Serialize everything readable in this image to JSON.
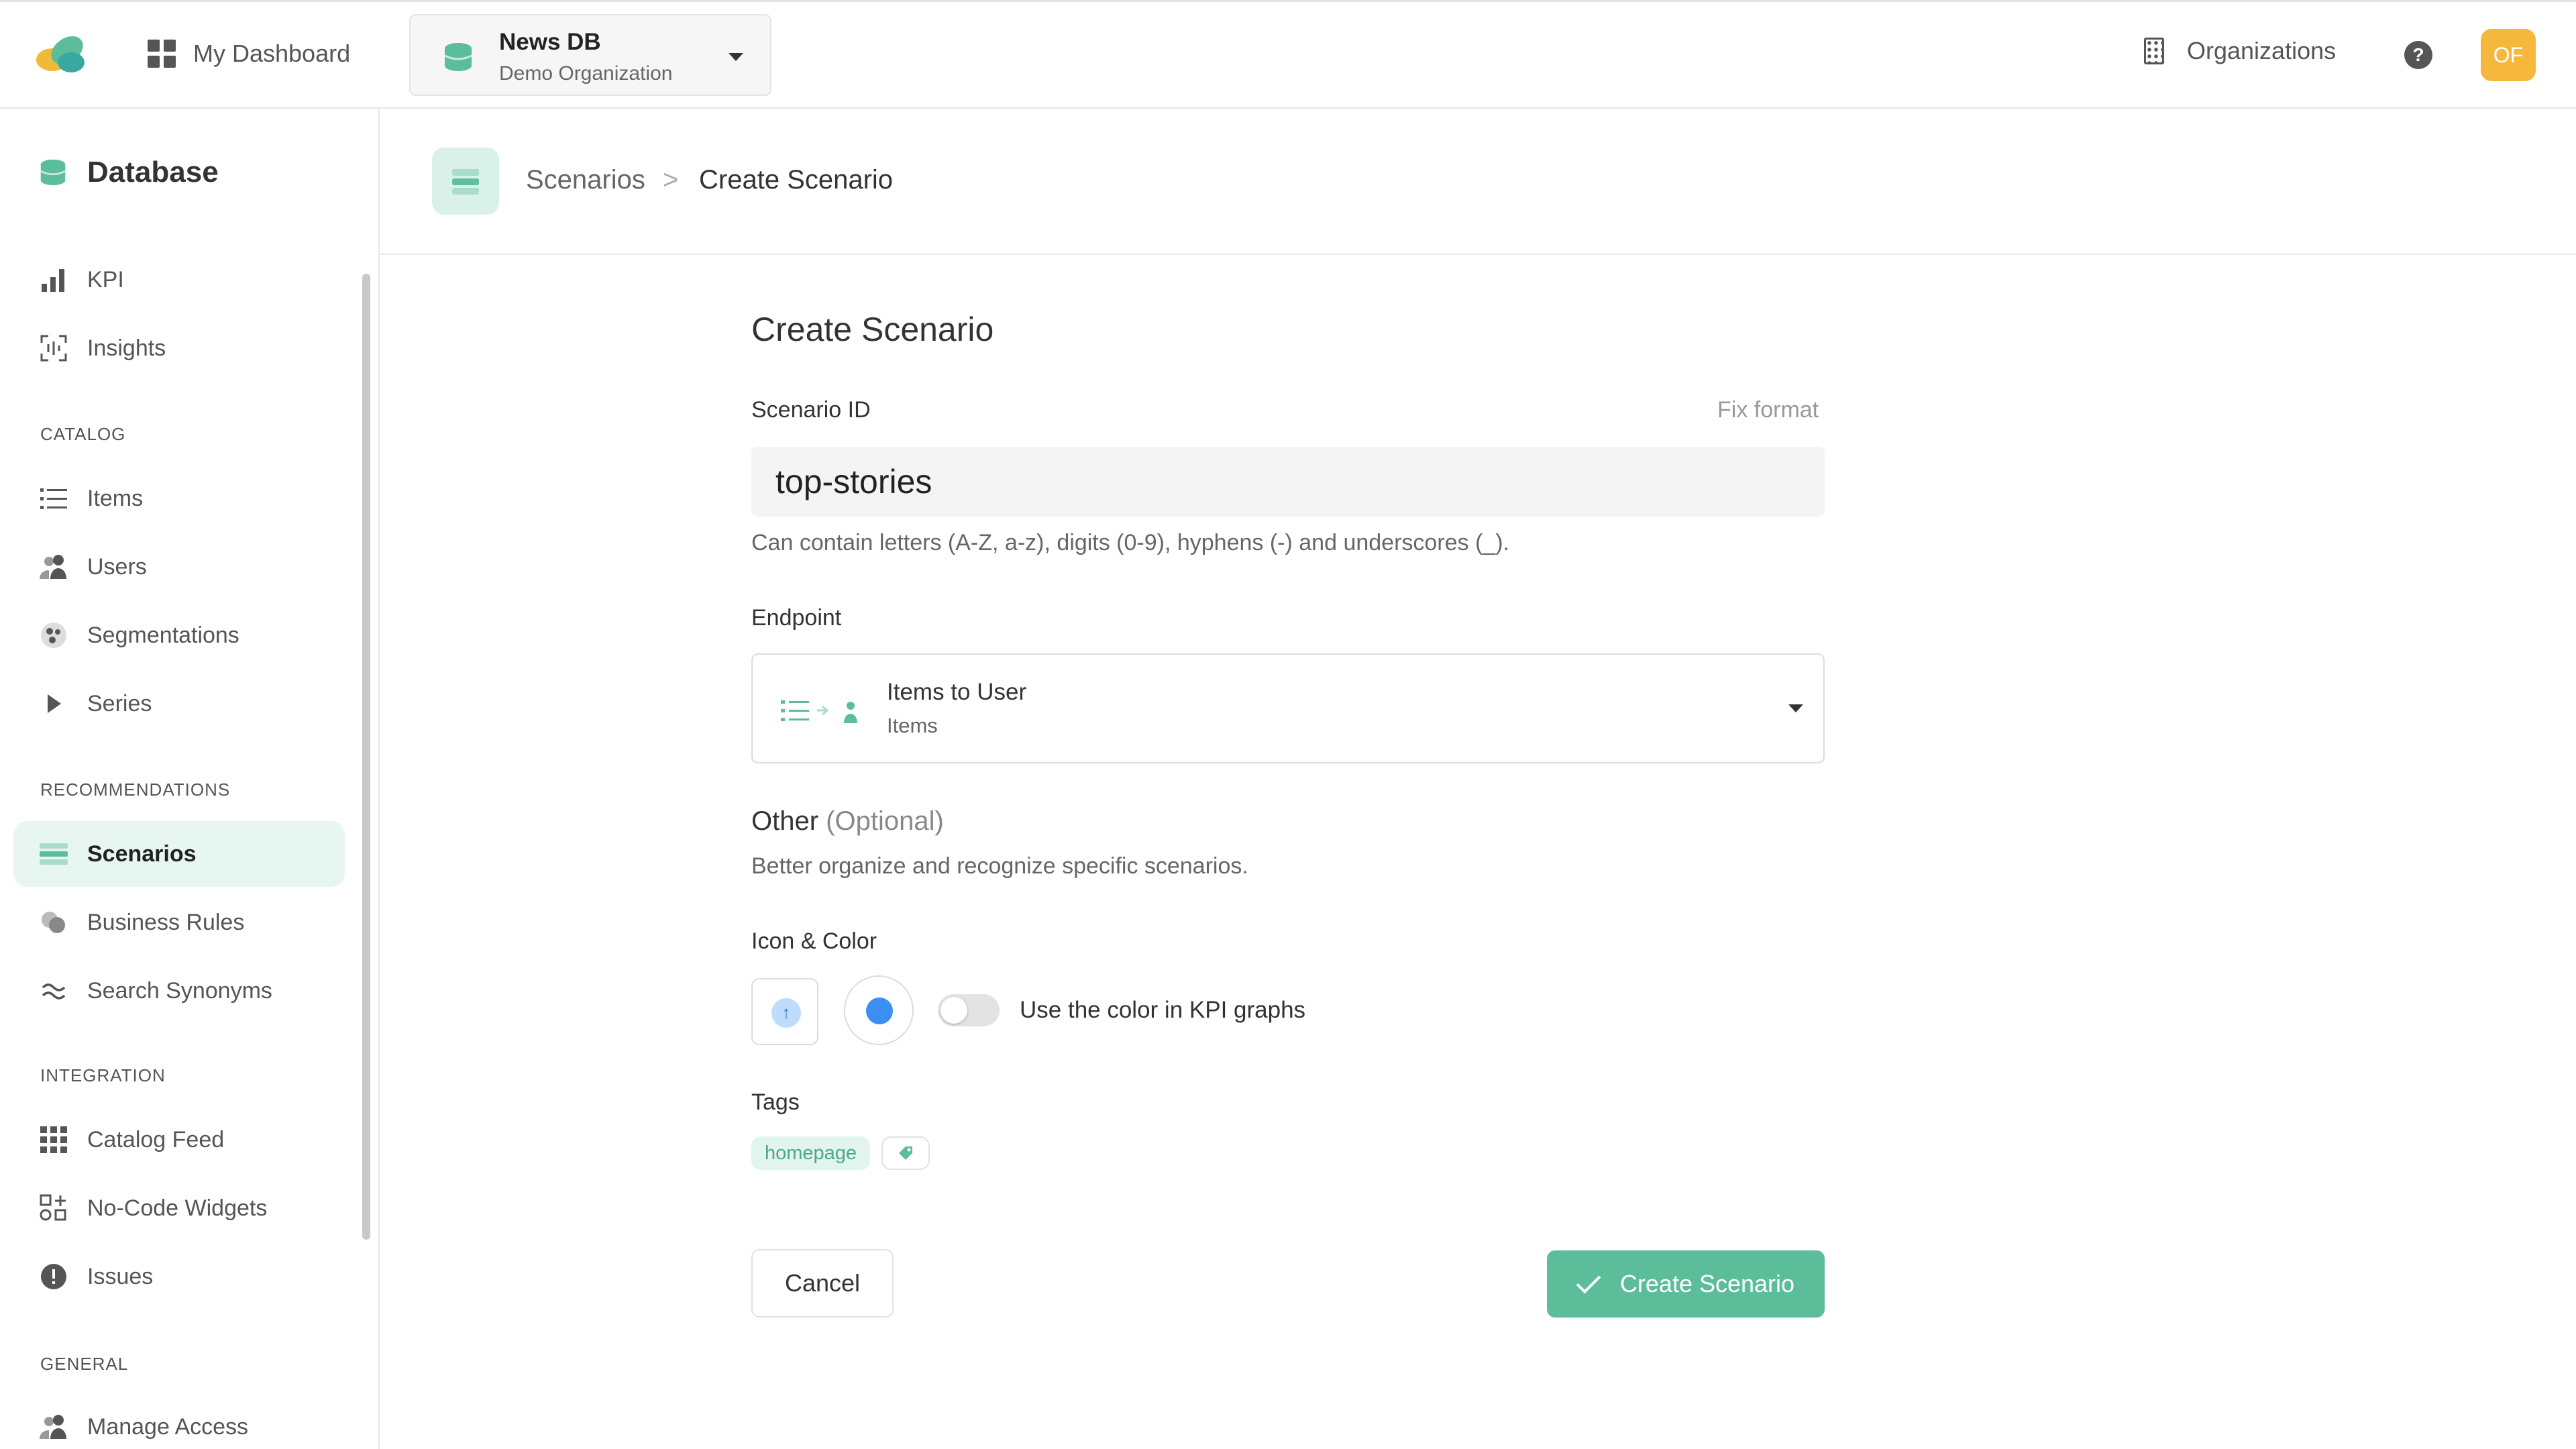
{
  "header": {
    "dashboard_label": "My Dashboard",
    "db_name": "News DB",
    "db_org": "Demo Organization",
    "organizations_label": "Organizations",
    "help_label": "?",
    "avatar_initials": "OF"
  },
  "sidebar": {
    "title": "Database",
    "top_items": [
      {
        "label": "KPI",
        "icon": "bar-chart-icon"
      },
      {
        "label": "Insights",
        "icon": "insights-icon"
      }
    ],
    "sections": [
      {
        "title": "CATALOG",
        "items": [
          {
            "label": "Items",
            "icon": "list-icon"
          },
          {
            "label": "Users",
            "icon": "users-icon"
          },
          {
            "label": "Segmentations",
            "icon": "segmentations-icon"
          },
          {
            "label": "Series",
            "icon": "play-icon"
          }
        ]
      },
      {
        "title": "RECOMMENDATIONS",
        "items": [
          {
            "label": "Scenarios",
            "icon": "scenarios-icon",
            "active": true
          },
          {
            "label": "Business Rules",
            "icon": "business-rules-icon"
          },
          {
            "label": "Search Synonyms",
            "icon": "approx-icon"
          }
        ]
      },
      {
        "title": "INTEGRATION",
        "items": [
          {
            "label": "Catalog Feed",
            "icon": "grid-icon"
          },
          {
            "label": "No-Code Widgets",
            "icon": "widgets-icon"
          },
          {
            "label": "Issues",
            "icon": "alert-icon"
          }
        ]
      },
      {
        "title": "GENERAL",
        "items": [
          {
            "label": "Manage Access",
            "icon": "users-icon"
          }
        ]
      }
    ]
  },
  "breadcrumb": {
    "parent": "Scenarios",
    "separator": ">",
    "current": "Create Scenario"
  },
  "form": {
    "title": "Create Scenario",
    "scenario_id_label": "Scenario ID",
    "fix_format": "Fix format",
    "scenario_id_value": "top-stories",
    "scenario_id_hint": "Can contain letters (A-Z, a-z), digits (0-9), hyphens (-) and underscores (_).",
    "endpoint_label": "Endpoint",
    "endpoint_title": "Items to User",
    "endpoint_sub": "Items",
    "other_title": "Other",
    "other_optional": "(Optional)",
    "other_sub": "Better organize and recognize specific scenarios.",
    "icon_color_label": "Icon & Color",
    "icon_glyph": "↑",
    "color_swatch": "#3a8ff0",
    "kpi_toggle_label": "Use the color in KPI graphs",
    "kpi_toggle_on": false,
    "tags_label": "Tags",
    "tags": [
      "homepage"
    ],
    "tag_add_icon": "tag-icon",
    "cancel_label": "Cancel",
    "create_label": "Create Scenario"
  },
  "colors": {
    "accent": "#5cbd9b",
    "accent_light": "#e8f6f1",
    "avatar": "#f5b83d",
    "scenario_color": "#3a8ff0"
  }
}
